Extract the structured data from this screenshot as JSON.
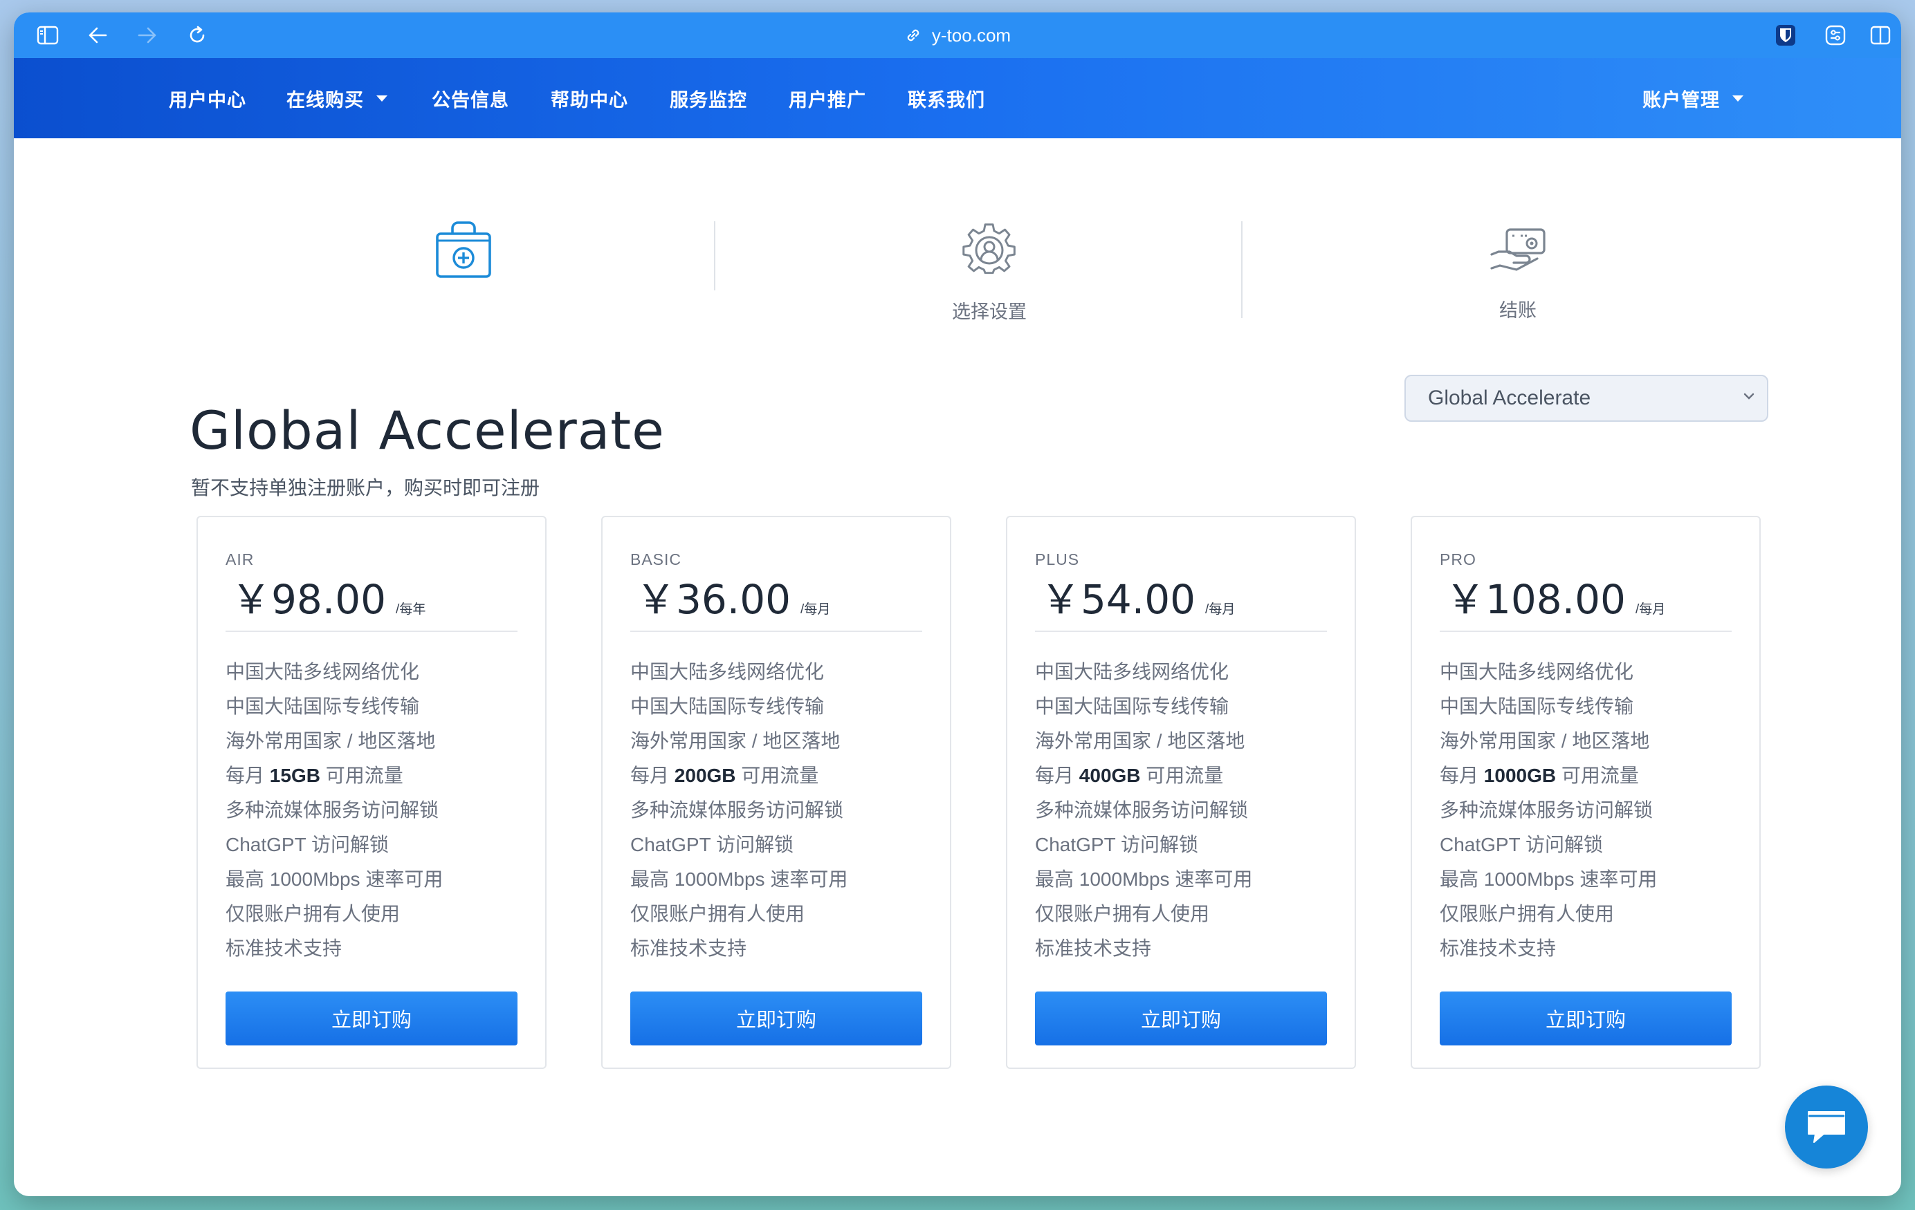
{
  "browser": {
    "url": "y-too.com",
    "icons": [
      "sidebar-icon",
      "back-icon",
      "forward-icon",
      "reload-icon",
      "link-icon",
      "bitwarden-icon",
      "extension-icon",
      "split-view-icon"
    ]
  },
  "nav": {
    "items": [
      "用户中心",
      "在线购买",
      "公告信息",
      "帮助中心",
      "服务监控",
      "用户推广",
      "联系我们"
    ],
    "account": "账户管理"
  },
  "steps": [
    {
      "label": "",
      "icon": "shopping-bag-plus-icon"
    },
    {
      "label": "选择设置",
      "icon": "gear-user-icon"
    },
    {
      "label": "结账",
      "icon": "hand-card-icon"
    }
  ],
  "page": {
    "title": "Global Accelerate",
    "subtitle": "暂不支持单独注册账户，购买时即可注册",
    "group_select": "Global Accelerate"
  },
  "plans": [
    {
      "tier": "AIR",
      "price": "￥98.00",
      "period": "/每年",
      "features": [
        "中国大陆多线网络优化",
        "中国大陆国际专线传输",
        "海外常用国家 / 地区落地",
        "每月",
        "15GB",
        "可用流量",
        "多种流媒体服务访问解锁",
        "ChatGPT 访问解锁",
        "最高 1000Mbps 速率可用",
        "仅限账户拥有人使用",
        "标准技术支持"
      ],
      "button": "立即订购"
    },
    {
      "tier": "BASIC",
      "price": "￥36.00",
      "period": "/每月",
      "features": [
        "中国大陆多线网络优化",
        "中国大陆国际专线传输",
        "海外常用国家 / 地区落地",
        "每月",
        "200GB",
        "可用流量",
        "多种流媒体服务访问解锁",
        "ChatGPT 访问解锁",
        "最高 1000Mbps 速率可用",
        "仅限账户拥有人使用",
        "标准技术支持"
      ],
      "button": "立即订购"
    },
    {
      "tier": "PLUS",
      "price": "￥54.00",
      "period": "/每月",
      "features": [
        "中国大陆多线网络优化",
        "中国大陆国际专线传输",
        "海外常用国家 / 地区落地",
        "每月",
        "400GB",
        "可用流量",
        "多种流媒体服务访问解锁",
        "ChatGPT 访问解锁",
        "最高 1000Mbps 速率可用",
        "仅限账户拥有人使用",
        "标准技术支持"
      ],
      "button": "立即订购"
    },
    {
      "tier": "PRO",
      "price": "￥108.00",
      "period": "/每月",
      "features": [
        "中国大陆多线网络优化",
        "中国大陆国际专线传输",
        "海外常用国家 / 地区落地",
        "每月",
        "1000GB",
        "可用流量",
        "多种流媒体服务访问解锁",
        "ChatGPT 访问解锁",
        "最高 1000Mbps 速率可用",
        "仅限账户拥有人使用",
        "标准技术支持"
      ],
      "button": "立即订购"
    }
  ],
  "colors": {
    "nav_start": "#0b4fcf",
    "nav_end": "#2f8ff8",
    "button": "#1a78ec",
    "chat": "#1685d8"
  },
  "chat": {
    "icon": "chat-bubble-icon"
  }
}
